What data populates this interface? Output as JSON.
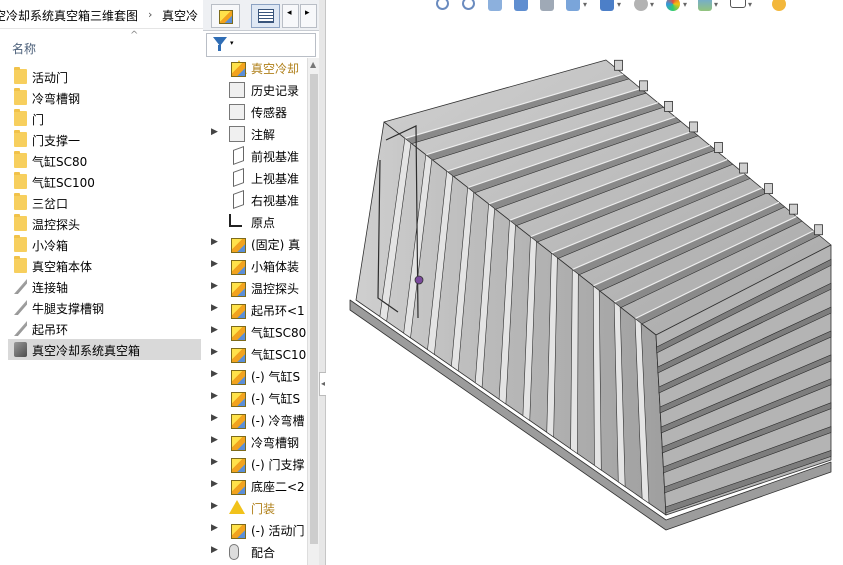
{
  "breadcrumb": [
    "空冷却系统真空箱三维套图",
    "真空冷"
  ],
  "explorer": {
    "column_name": "名称",
    "items": [
      {
        "label": "活动门",
        "type": "folder"
      },
      {
        "label": "冷弯槽钢",
        "type": "folder"
      },
      {
        "label": "门",
        "type": "folder"
      },
      {
        "label": "门支撑一",
        "type": "folder"
      },
      {
        "label": "气缸SC80",
        "type": "folder"
      },
      {
        "label": "气缸SC100",
        "type": "folder"
      },
      {
        "label": "三岔口",
        "type": "folder"
      },
      {
        "label": "温控探头",
        "type": "folder"
      },
      {
        "label": "小冷箱",
        "type": "folder"
      },
      {
        "label": "真空箱本体",
        "type": "folder"
      },
      {
        "label": "连接轴",
        "type": "part"
      },
      {
        "label": "牛腿支撑槽钢",
        "type": "part"
      },
      {
        "label": "起吊环",
        "type": "part"
      },
      {
        "label": "真空冷却系统真空箱",
        "type": "assembly",
        "selected": true
      }
    ]
  },
  "tree": {
    "items": [
      {
        "label": "真空冷却",
        "icon": "warning-icon",
        "expand": "",
        "root": true,
        "warn": true
      },
      {
        "label": "历史记录",
        "icon": "history-icon",
        "expand": ""
      },
      {
        "label": "传感器",
        "icon": "sensor-icon",
        "expand": ""
      },
      {
        "label": "注解",
        "icon": "annotation-icon",
        "expand": "▶"
      },
      {
        "label": "前视基准",
        "icon": "plane-icon",
        "expand": ""
      },
      {
        "label": "上视基准",
        "icon": "plane-icon",
        "expand": ""
      },
      {
        "label": "右视基准",
        "icon": "plane-icon",
        "expand": ""
      },
      {
        "label": "原点",
        "icon": "origin-icon",
        "expand": ""
      },
      {
        "label": "(固定) 真",
        "icon": "component-icon",
        "expand": "▶"
      },
      {
        "label": "小箱体装",
        "icon": "component-icon",
        "expand": "▶"
      },
      {
        "label": "温控探头",
        "icon": "component-icon",
        "expand": "▶"
      },
      {
        "label": "起吊环<1",
        "icon": "component-icon",
        "expand": "▶"
      },
      {
        "label": "气缸SC80",
        "icon": "component-icon",
        "expand": "▶"
      },
      {
        "label": "气缸SC10",
        "icon": "component-icon",
        "expand": "▶"
      },
      {
        "label": "(-) 气缸S",
        "icon": "component-icon",
        "expand": "▶"
      },
      {
        "label": "(-) 气缸S",
        "icon": "component-icon",
        "expand": "▶"
      },
      {
        "label": "(-) 冷弯槽",
        "icon": "component-icon",
        "expand": "▶"
      },
      {
        "label": "冷弯槽钢",
        "icon": "component-icon",
        "expand": "▶"
      },
      {
        "label": "(-) 门支撑",
        "icon": "component-icon",
        "expand": "▶"
      },
      {
        "label": "底座二<2",
        "icon": "component-icon",
        "expand": "▶"
      },
      {
        "label": "门装",
        "icon": "warning-icon",
        "expand": "▶",
        "warn": true
      },
      {
        "label": "(-) 活动门",
        "icon": "component-icon",
        "expand": "▶"
      },
      {
        "label": "配合",
        "icon": "mate-icon",
        "expand": "▶"
      }
    ]
  },
  "colors": {
    "selection": "#d9d9d9",
    "warning": "#f1c21b",
    "model_steel": "#b9b9b9"
  }
}
